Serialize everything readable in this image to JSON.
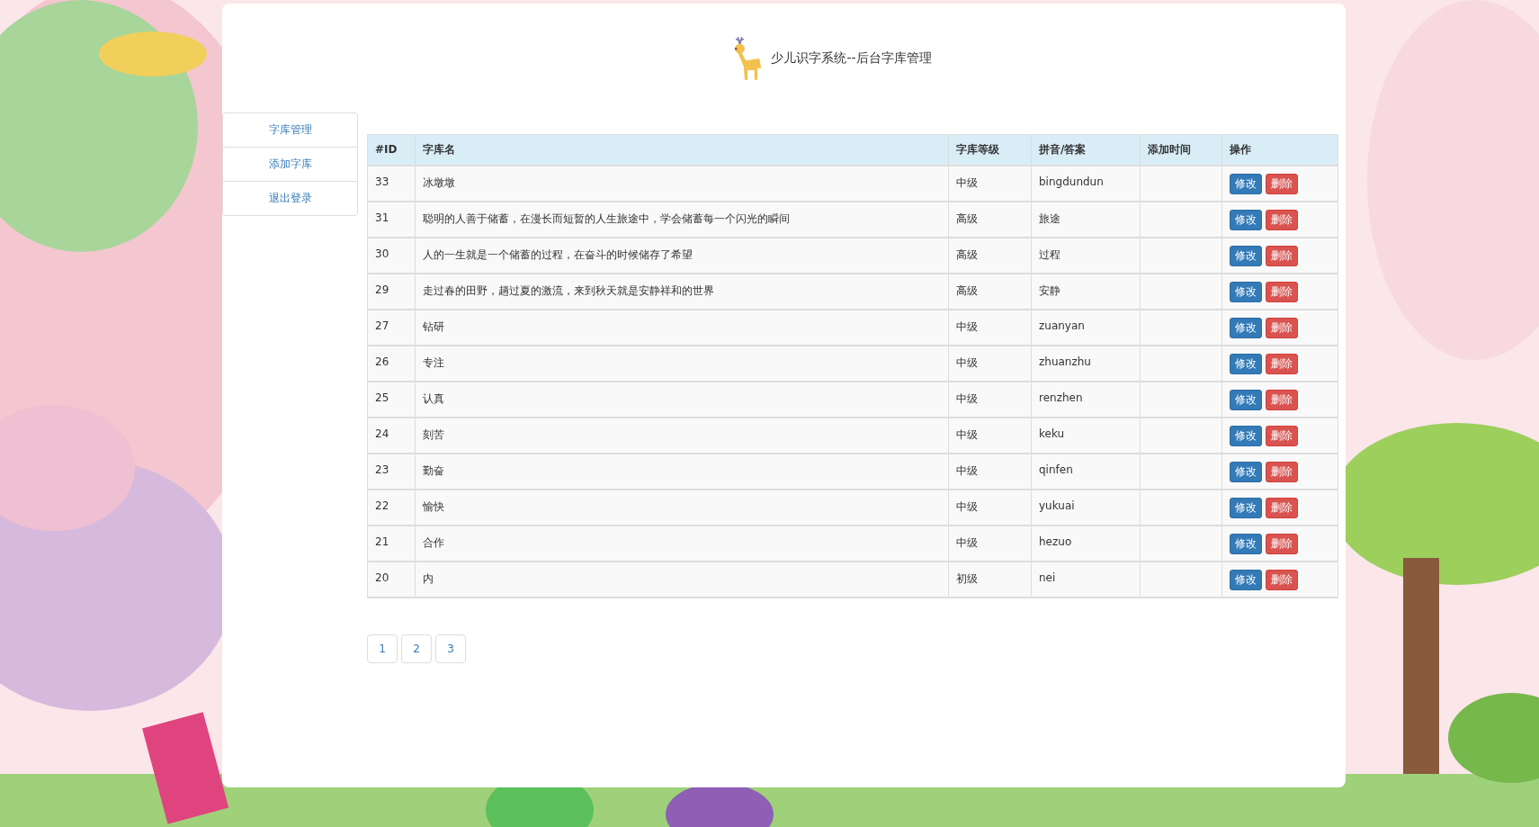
{
  "header": {
    "title": "少儿识字系统--后台字库管理"
  },
  "sidebar": {
    "items": [
      {
        "label": "字库管理"
      },
      {
        "label": "添加字库"
      },
      {
        "label": "退出登录"
      }
    ]
  },
  "table": {
    "columns": [
      "#ID",
      "字库名",
      "字库等级",
      "拼音/答案",
      "添加时间",
      "操作"
    ],
    "rows": [
      {
        "id": "33",
        "name": "冰墩墩",
        "level": "中级",
        "answer": "bingdundun",
        "actions": [
          {
            "label": "修改",
            "kind": "edit"
          },
          {
            "label": "删除",
            "kind": "delete"
          }
        ]
      },
      {
        "id": "31",
        "name": "聪明的人善于储蓄，在漫长而短暂的人生旅途中，学会储蓄每一个闪光的瞬间",
        "level": "高级",
        "answer": "旅途",
        "actions": [
          {
            "label": "修改",
            "kind": "edit"
          },
          {
            "label": "删除",
            "kind": "delete"
          }
        ]
      },
      {
        "id": "30",
        "name": "人的一生就是一个储蓄的过程，在奋斗的时候储存了希望",
        "level": "高级",
        "answer": "过程",
        "actions": [
          {
            "label": "修改",
            "kind": "edit"
          },
          {
            "label": "删除",
            "kind": "delete"
          }
        ]
      },
      {
        "id": "29",
        "name": "走过春的田野，趟过夏的激流，来到秋天就是安静祥和的世界",
        "level": "高级",
        "answer": "安静",
        "actions": [
          {
            "label": "修改",
            "kind": "edit"
          },
          {
            "label": "删除",
            "kind": "delete"
          }
        ]
      },
      {
        "id": "27",
        "name": "钻研",
        "level": "中级",
        "answer": "zuanyan",
        "actions": [
          {
            "label": "修改",
            "kind": "edit"
          },
          {
            "label": "删除",
            "kind": "delete"
          }
        ]
      },
      {
        "id": "26",
        "name": "专注",
        "level": "中级",
        "answer": "zhuanzhu",
        "actions": [
          {
            "label": "修改",
            "kind": "edit"
          },
          {
            "label": "删除",
            "kind": "delete"
          }
        ]
      },
      {
        "id": "25",
        "name": "认真",
        "level": "中级",
        "answer": "renzhen",
        "actions": [
          {
            "label": "修改",
            "kind": "edit"
          },
          {
            "label": "删除",
            "kind": "delete"
          }
        ]
      },
      {
        "id": "24",
        "name": "刻苦",
        "level": "中级",
        "answer": "keku",
        "actions": [
          {
            "label": "修改",
            "kind": "edit"
          },
          {
            "label": "删除",
            "kind": "delete"
          }
        ]
      },
      {
        "id": "23",
        "name": "勤奋",
        "level": "中级",
        "answer": "qinfen",
        "actions": [
          {
            "label": "修改",
            "kind": "edit"
          },
          {
            "label": "删除",
            "kind": "delete"
          }
        ]
      },
      {
        "id": "22",
        "name": "愉快",
        "level": "中级",
        "answer": "yukuai",
        "actions": [
          {
            "label": "修改",
            "kind": "edit"
          },
          {
            "label": "删除",
            "kind": "delete"
          }
        ]
      },
      {
        "id": "21",
        "name": "合作",
        "level": "中级",
        "answer": "hezuo",
        "actions": [
          {
            "label": "修改",
            "kind": "edit"
          },
          {
            "label": "删除",
            "kind": "delete"
          }
        ]
      },
      {
        "id": "20",
        "name": "内",
        "level": "初级",
        "answer": "nei",
        "actions": [
          {
            "label": "修改",
            "kind": "edit"
          },
          {
            "label": "删除",
            "kind": "delete"
          }
        ]
      }
    ]
  },
  "pagination": {
    "pages": [
      "1",
      "2",
      "3"
    ]
  }
}
